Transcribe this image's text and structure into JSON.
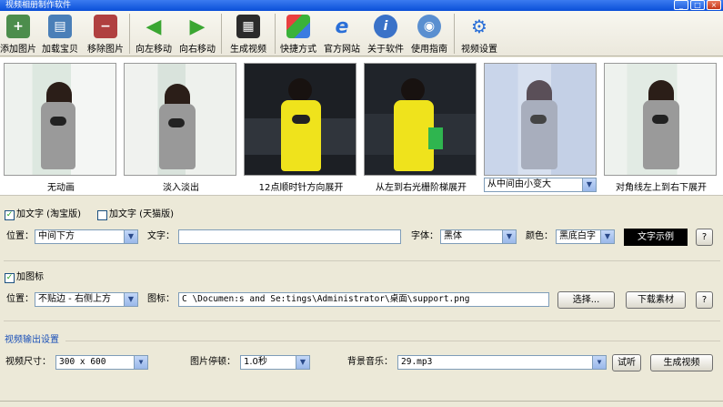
{
  "window": {
    "title": "视频相册制作软件"
  },
  "toolbar": {
    "add_image": "添加图片",
    "load_item": "加载宝贝",
    "remove_image": "移除图片",
    "move_left": "向左移动",
    "move_right": "向右移动",
    "generate_video": "生成视频",
    "shortcut": "快捷方式",
    "website": "官方网站",
    "about": "关于软件",
    "guide": "使用指南",
    "video_settings": "视频设置"
  },
  "thumbnails": [
    {
      "caption": "无动画"
    },
    {
      "caption": "淡入淡出"
    },
    {
      "caption": "12点顺时针方向展开"
    },
    {
      "caption": "从左到右光栅阶梯展开"
    },
    {
      "caption": "从中间由小变大",
      "is_dropdown": true
    },
    {
      "caption": "对角线左上到右下展开"
    }
  ],
  "text_section": {
    "taobao_label": "加文字 (淘宝版)",
    "taobao_checked": true,
    "tmall_label": "加文字 (天猫版)",
    "tmall_checked": false,
    "position_label": "位置：",
    "position_value": "中间下方",
    "text_label": "文字：",
    "text_value": "",
    "font_label": "字体：",
    "font_value": "黑体",
    "color_label": "颜色：",
    "color_value": "黑底白字",
    "sample_text": "文字示例",
    "help": "?"
  },
  "icon_section": {
    "label": "加图标",
    "checked": true,
    "position_label": "位置：",
    "position_value": "不贴边 - 右侧上方",
    "icon_label": "图标：",
    "icon_path": "C \\Documen:s and Se:tings\\Administrator\\桌面\\support.png",
    "browse": "选择...",
    "download": "下载素材",
    "help": "?"
  },
  "output_section": {
    "title": "视频输出设置",
    "size_label": "视频尺寸：",
    "size_value": "300 x 600",
    "pause_label": "图片停顿：",
    "pause_value": "1.0秒",
    "music_label": "背景音乐：",
    "music_value": "29.mp3",
    "listen": "试听",
    "generate": "生成视频"
  },
  "colors": {
    "accent_blue": "#1a50b8",
    "bg": "#ece9d8",
    "sample_bg": "#000000"
  }
}
